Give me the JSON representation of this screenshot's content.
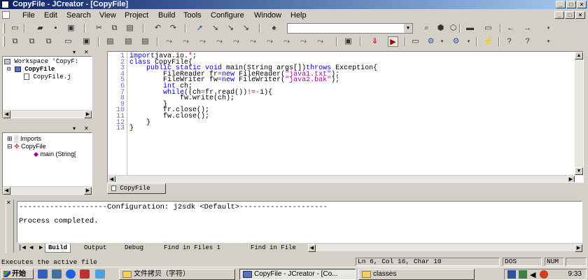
{
  "window": {
    "title": "CopyFile - JCreator - [CopyFile]"
  },
  "menu": [
    "File",
    "Edit",
    "Search",
    "View",
    "Project",
    "Build",
    "Tools",
    "Configure",
    "Window",
    "Help"
  ],
  "toolbar": {
    "search_value": ""
  },
  "workspace": {
    "root": "Workspace 'CopyF:",
    "project": "CopyFile",
    "file": "CopyFile.j"
  },
  "classview": {
    "imports": "Imports",
    "class": "CopyFile",
    "method": "main (String["
  },
  "editor": {
    "lines": [
      {
        "n": "1",
        "indent": "",
        "parts": [
          [
            "kw",
            "import"
          ],
          [
            "",
            "java.io."
          ],
          [
            "op",
            "*"
          ],
          [
            "",
            ";"
          ]
        ]
      },
      {
        "n": "2",
        "indent": "",
        "parts": [
          [
            "kw",
            "class"
          ],
          [
            "",
            " CopyFile{"
          ]
        ]
      },
      {
        "n": "3",
        "indent": "    ",
        "parts": [
          [
            "kw",
            "public static void"
          ],
          [
            "",
            " main(String args[])"
          ],
          [
            "kw",
            "throws"
          ],
          [
            "",
            " Exception{"
          ]
        ]
      },
      {
        "n": "4",
        "indent": "        ",
        "parts": [
          [
            "",
            "FileReader fr"
          ],
          [
            "op",
            "="
          ],
          [
            "kw",
            "new"
          ],
          [
            "",
            " FileReader("
          ],
          [
            "str",
            "\"java1.txt\""
          ],
          [
            "",
            ");"
          ]
        ]
      },
      {
        "n": "5",
        "indent": "        ",
        "parts": [
          [
            "",
            "FileWriter fw"
          ],
          [
            "op",
            "="
          ],
          [
            "kw",
            "new"
          ],
          [
            "",
            " FileWriter("
          ],
          [
            "str",
            "\"java2.bak\""
          ],
          [
            "",
            ");"
          ]
        ]
      },
      {
        "n": "6",
        "indent": "        ",
        "parts": [
          [
            "kw",
            "int"
          ],
          [
            "",
            " ch;"
          ]
        ]
      },
      {
        "n": "7",
        "indent": "        ",
        "parts": [
          [
            "kw",
            "while"
          ],
          [
            "",
            "((ch"
          ],
          [
            "op",
            "="
          ],
          [
            "",
            "fr.read())"
          ],
          [
            "op",
            "!=-"
          ],
          [
            "",
            "1){"
          ]
        ]
      },
      {
        "n": "8",
        "indent": "            ",
        "parts": [
          [
            "",
            "fw.write(ch);"
          ]
        ]
      },
      {
        "n": "9",
        "indent": "        ",
        "parts": [
          [
            "",
            "}"
          ]
        ]
      },
      {
        "n": "10",
        "indent": "        ",
        "parts": [
          [
            "",
            "fr.close();"
          ]
        ]
      },
      {
        "n": "11",
        "indent": "        ",
        "parts": [
          [
            "",
            "fw.close();"
          ]
        ]
      },
      {
        "n": "12",
        "indent": "    ",
        "parts": [
          [
            "",
            "}"
          ]
        ]
      },
      {
        "n": "13",
        "indent": "",
        "parts": [
          [
            "",
            "}"
          ]
        ]
      }
    ],
    "tab_label": "CopyFile"
  },
  "output": {
    "config_line": "--------------------Configuration: j2sdk <Default>--------------------",
    "status_line": "Process completed.",
    "tabs": [
      "Build",
      "Output",
      "Debug",
      "Find in Files 1",
      "Find in File"
    ]
  },
  "statusbar": {
    "message": "Executes the active file",
    "position": "Ln 6, Col 16, Char 10",
    "mode": "DOS",
    "num": "NUM"
  },
  "taskbar": {
    "start": "开始",
    "tasks": [
      "文件拷贝（字符）",
      "CopyFile - JCreator - [Co...",
      "classes"
    ],
    "clock": "9:33"
  }
}
